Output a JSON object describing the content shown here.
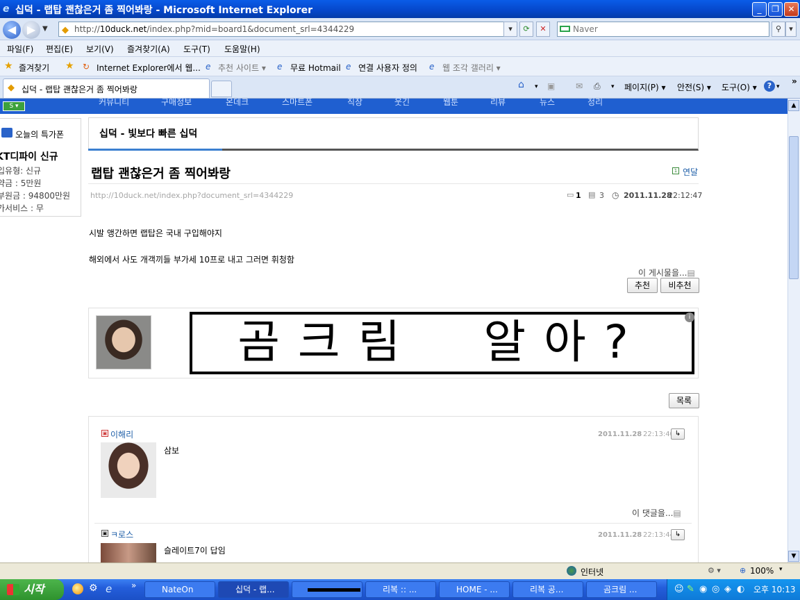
{
  "window": {
    "title": "십덕 - 랩탑 괜찮은거 좀 찍어봐랑 - Microsoft Internet Explorer",
    "min": "_",
    "max": "❐",
    "close": "✕"
  },
  "address": {
    "url_prefix": "http://",
    "url_domain": "10duck.net",
    "url_rest": "/index.php?mid=board1&document_srl=4344229",
    "search_placeholder": "Naver"
  },
  "menu": [
    "파일(F)",
    "편집(E)",
    "보기(V)",
    "즐겨찾기(A)",
    "도구(T)",
    "도움말(H)"
  ],
  "favorites": {
    "label": "즐겨찾기",
    "items": [
      "Internet Explorer에서 웹...",
      "추천 사이트 ▾",
      "무료 Hotmail",
      "연결 사용자 정의",
      "웹 조각 갤러리 ▾"
    ]
  },
  "tab": {
    "label": "십덕 - 랩탑 괜찮은거 좀 찍어봐랑"
  },
  "commandbar": {
    "page": "페이지(P) ▾",
    "safety": "안전(S) ▾",
    "tools": "도구(O) ▾"
  },
  "site_nav": [
    "커뮤니티",
    "구매정보",
    "온데크",
    "스마트폰",
    "직장",
    "웃긴",
    "웹툰",
    "리뷰",
    "뉴스",
    "정리"
  ],
  "sidebar": {
    "coupon_title": "오늘의 특가폰",
    "product": "KT디파이 신규",
    "lines": [
      "입유형: 신규",
      "약금 : 5만원",
      "부원금 : 94800만원",
      "가서비스 : 무"
    ]
  },
  "board": {
    "tab_label": "십덕 - 빛보다 빠른 십덕",
    "post_title": "랩탑 괜찮은거 좀 찍어봐랑",
    "author": "연달",
    "permalink": "http://10duck.net/index.php?document_srl=4344229",
    "comment_count": "1",
    "read_count": "3",
    "date": "2011.11.28",
    "time": "22:12:47",
    "body": [
      "시발 앵간하면 랩탑은 국내 구입해야지",
      "해외에서 사도 개객끼들 부가세 10프로 내고 그러면 휘청함"
    ],
    "post_menu": "이 게시물을...",
    "recommend": "추천",
    "not_recommend": "비추천",
    "signature": "곰크림  알아?",
    "list_button": "목록"
  },
  "comments": [
    {
      "author": "이해리",
      "date": "2011.11.28",
      "time": "22:13:40",
      "text": "삼보",
      "menu": "이 댓글을..."
    },
    {
      "author": "ㅋ로스",
      "date": "2011.11.28",
      "time": "22:13:44",
      "text": "슬레이트7이 답임"
    }
  ],
  "status": {
    "zone": "인터넷",
    "zoom": "100%"
  },
  "taskbar": {
    "start": "시작",
    "items": [
      "NateOn",
      "십덕 - 랩...",
      "",
      "리복 :: ...",
      "HOME - ...",
      "리복 공...",
      "곰크림 ..."
    ],
    "clock": "오후 10:13"
  },
  "colors": {
    "title_blue": "#0a5ce8",
    "site_blue": "#1f5fd0",
    "link": "#1f5fa8"
  }
}
